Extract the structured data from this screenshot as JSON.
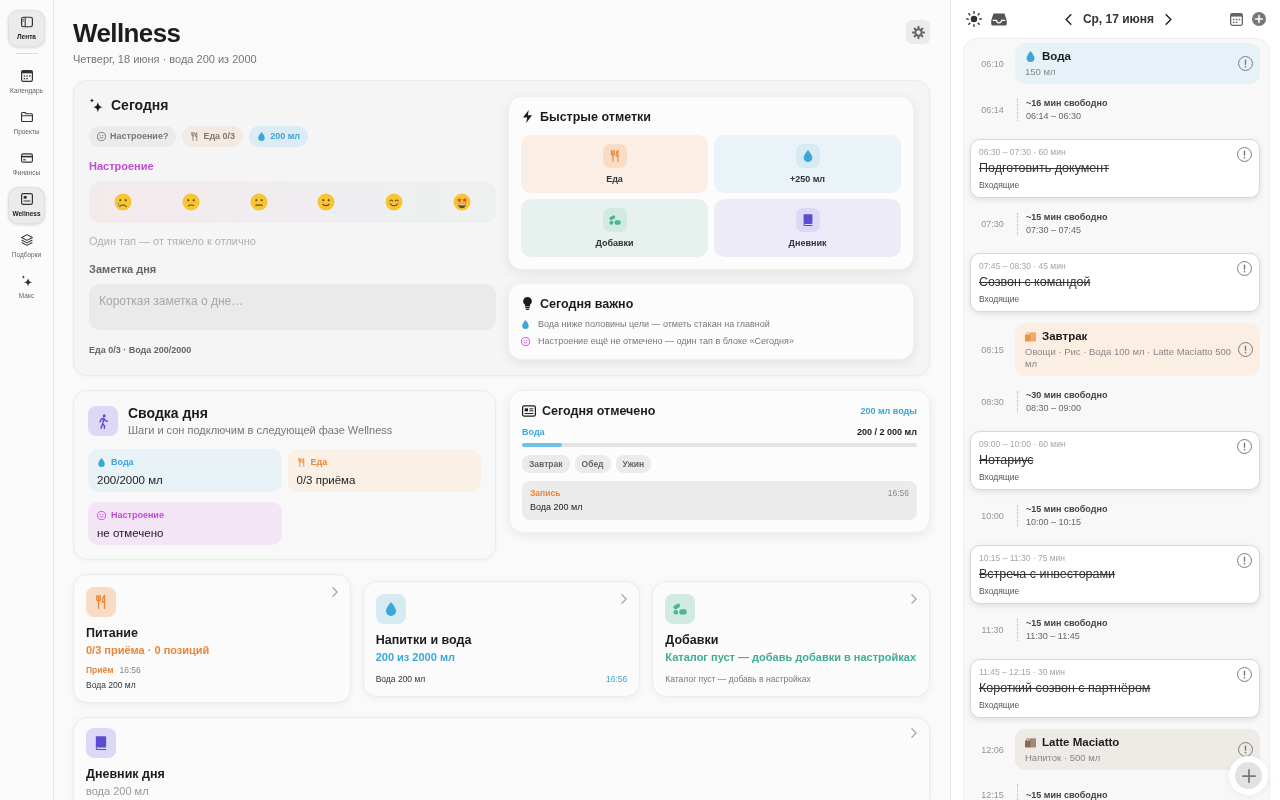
{
  "sidebar": {
    "items": [
      {
        "label": "Лента",
        "selected": true
      },
      {
        "label": "Календарь",
        "selected": false
      },
      {
        "label": "Проекты",
        "selected": false
      },
      {
        "label": "Финансы",
        "selected": false
      },
      {
        "label": "Wellness",
        "selected": true
      },
      {
        "label": "Подборки",
        "selected": false
      },
      {
        "label": "Макс",
        "selected": false
      }
    ]
  },
  "header": {
    "title": "Wellness",
    "subtitle": "Четверг, 18 июня · вода 200 из 2000"
  },
  "today": {
    "title": "Сегодня",
    "chips": [
      {
        "kind": "mood",
        "label": "Настроение?"
      },
      {
        "kind": "food",
        "label": "Еда 0/3"
      },
      {
        "kind": "water",
        "label": "200 мл"
      }
    ],
    "mood": {
      "label": "Настроение",
      "options": [
        {
          "selected": false
        },
        {
          "selected": false
        },
        {
          "selected": false
        },
        {
          "selected": false
        },
        {
          "selected": false
        },
        {
          "selected": false
        }
      ],
      "hint": "Один тап — от тяжело к отлично"
    },
    "note": {
      "label": "Заметка дня",
      "placeholder": "Короткая заметка о дне…"
    },
    "footer": "Еда 0/3 · Вода 200/2000"
  },
  "quick": {
    "title": "Быстрые отметки",
    "tiles": [
      {
        "kind": "food",
        "label": "Еда"
      },
      {
        "kind": "water",
        "label": "+250 мл"
      },
      {
        "kind": "supplements",
        "label": "Добавки"
      },
      {
        "kind": "diary",
        "label": "Дневник"
      }
    ]
  },
  "important": {
    "title": "Сегодня важно",
    "items": [
      {
        "kind": "water",
        "text": "Вода ниже половины цели — отметь стакан на главной"
      },
      {
        "kind": "mood",
        "text": "Настроение ещё не отмечено — один тап в блоке «Сегодня»"
      }
    ]
  },
  "summary": {
    "title": "Сводка дня",
    "subtitle": "Шаги и сон подключим в следующей фазе Wellness",
    "tiles": [
      {
        "kind": "water",
        "label": "Вода",
        "value": "200/2000 мл"
      },
      {
        "kind": "food",
        "label": "Еда",
        "value": "0/3 приёма"
      },
      {
        "kind": "mood",
        "label": "Настроение",
        "value": "не отмечено"
      }
    ]
  },
  "logged": {
    "title": "Сегодня отмечено",
    "badge": "200 мл воды",
    "progress": {
      "label": "Вода",
      "reading": "200 / 2 000 мл",
      "level": 0.1
    },
    "meals": [
      {
        "label": "Завтрак",
        "checked": false
      },
      {
        "label": "Обед",
        "checked": false
      },
      {
        "label": "Ужин",
        "checked": false
      }
    ],
    "entry": {
      "label": "Запись",
      "time": "16:56",
      "text": "Вода 200 мл"
    }
  },
  "modules": [
    {
      "kind": "food",
      "title": "Питание",
      "summary": "0/3 приёма · 0 позиций",
      "entry_label": "Приём",
      "time": "16:56",
      "detail": "Вода 200 мл"
    },
    {
      "kind": "water",
      "title": "Напитки и вода",
      "summary": "200 из 2000 мл",
      "detail": "Вода 200 мл",
      "time": "16:56"
    },
    {
      "kind": "supplements",
      "title": "Добавки",
      "summary": "Каталог пуст — добавь добавки в настройках",
      "detail": "Каталог пуст — добавь в настройках"
    }
  ],
  "diary": {
    "title": "Дневник дня",
    "summary": "вода 200 мл"
  },
  "day": {
    "date": "Ср, 17 июня",
    "timeline": [
      {
        "kind": "water",
        "time": "06:10",
        "title": "Вода",
        "detail": "150 мл"
      },
      {
        "kind": "gap",
        "time": "06:14",
        "title": "~16 мин свободно",
        "range": "06:14 – 06:30"
      },
      {
        "kind": "task",
        "meta": "06:30 – 07:30 · 60 мин",
        "title": "Подготовить документ",
        "list": "Входящие",
        "done": true
      },
      {
        "kind": "gap",
        "time": "07:30",
        "title": "~15 мин свободно",
        "range": "07:30 – 07:45"
      },
      {
        "kind": "task",
        "meta": "07:45 – 08:30 · 45 мин",
        "title": "Созвон с командой",
        "list": "Входящие",
        "done": true
      },
      {
        "kind": "meal",
        "time": "08:15",
        "title": "Завтрак",
        "detail": "Овощи · Рис · Вода 100 мл · Latte Maciatto 500 мл"
      },
      {
        "kind": "gap",
        "time": "08:30",
        "title": "~30 мин свободно",
        "range": "08:30 – 09:00"
      },
      {
        "kind": "task",
        "meta": "09:00 – 10:00 · 60 мин",
        "title": "Нотариус",
        "list": "Входящие",
        "done": true
      },
      {
        "kind": "gap",
        "time": "10:00",
        "title": "~15 мин свободно",
        "range": "10:00 – 10:15"
      },
      {
        "kind": "task",
        "meta": "10:15 – 11:30 · 75 мин",
        "title": "Встреча с инвесторами",
        "list": "Входящие",
        "done": true
      },
      {
        "kind": "gap",
        "time": "11:30",
        "title": "~15 мин свободно",
        "range": "11:30 – 11:45"
      },
      {
        "kind": "task",
        "meta": "11:45 – 12:15 · 30 мин",
        "title": "Короткий созвон с партнёром",
        "list": "Входящие",
        "done": true
      },
      {
        "kind": "drink",
        "time": "12:06",
        "title": "Latte Maciatto",
        "detail": "Напиток · 500 мл"
      },
      {
        "kind": "gap",
        "time": "12:15",
        "title": "~15 мин свободно"
      }
    ]
  }
}
